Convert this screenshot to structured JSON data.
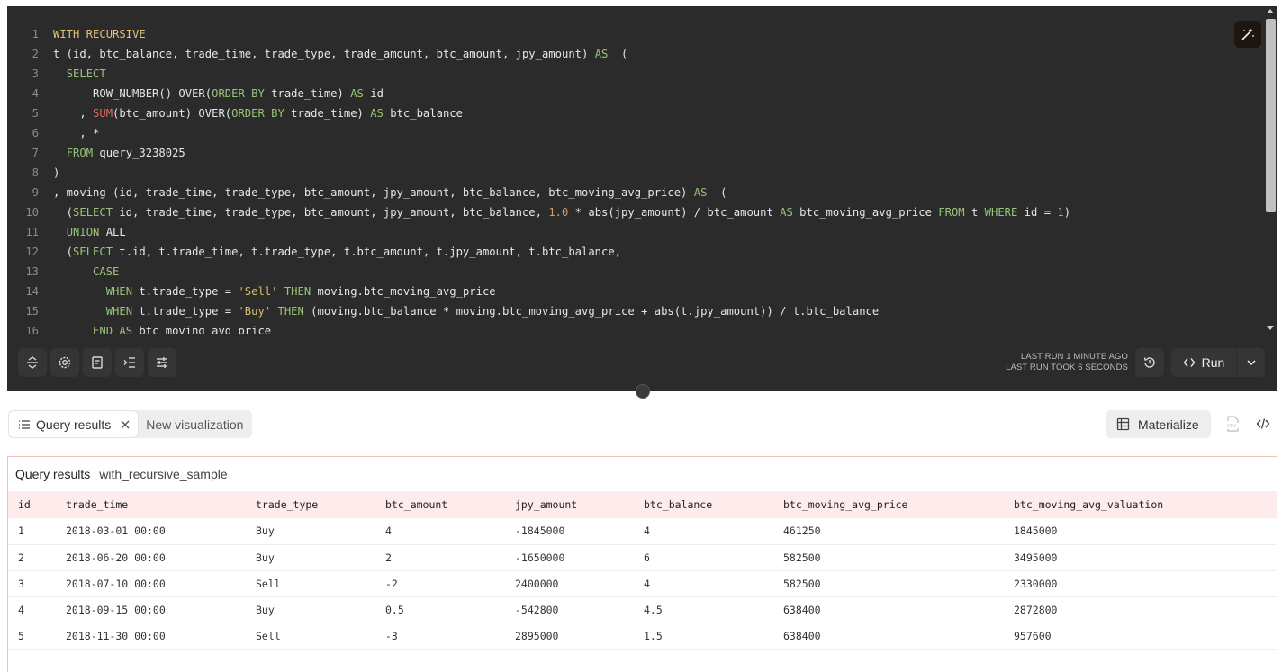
{
  "editor": {
    "lines": [
      {
        "n": "1",
        "parts": [
          [
            "kw",
            "WITH RECURSIVE"
          ]
        ]
      },
      {
        "n": "2",
        "parts": [
          [
            "",
            "t (id, btc_balance, trade_time, trade_type, trade_amount, btc_amount, jpy_amount) "
          ],
          [
            "green",
            "AS"
          ],
          [
            "",
            "  ("
          ]
        ]
      },
      {
        "n": "3",
        "parts": [
          [
            "",
            "  "
          ],
          [
            "green",
            "SELECT"
          ]
        ]
      },
      {
        "n": "4",
        "parts": [
          [
            "",
            "      ROW_NUMBER() OVER("
          ],
          [
            "green",
            "ORDER BY"
          ],
          [
            "",
            " trade_time) "
          ],
          [
            "green",
            "AS"
          ],
          [
            "",
            " id"
          ]
        ]
      },
      {
        "n": "5",
        "parts": [
          [
            "",
            "    , "
          ],
          [
            "fn-red",
            "SUM"
          ],
          [
            "",
            "(btc_amount) OVER("
          ],
          [
            "green",
            "ORDER BY"
          ],
          [
            "",
            " trade_time) "
          ],
          [
            "green",
            "AS"
          ],
          [
            "",
            " btc_balance"
          ]
        ]
      },
      {
        "n": "6",
        "parts": [
          [
            "",
            "    , *"
          ]
        ]
      },
      {
        "n": "7",
        "parts": [
          [
            "",
            "  "
          ],
          [
            "green",
            "FROM"
          ],
          [
            "",
            " query_3238025"
          ]
        ]
      },
      {
        "n": "8",
        "parts": [
          [
            "",
            ")"
          ]
        ]
      },
      {
        "n": "9",
        "parts": [
          [
            "",
            ", moving (id, trade_time, trade_type, btc_amount, jpy_amount, btc_balance, btc_moving_avg_price) "
          ],
          [
            "green",
            "AS"
          ],
          [
            "",
            "  ("
          ]
        ]
      },
      {
        "n": "10",
        "parts": [
          [
            "",
            "  ("
          ],
          [
            "green",
            "SELECT"
          ],
          [
            "",
            " id, trade_time, trade_type, btc_amount, jpy_amount, btc_balance, "
          ],
          [
            "num",
            "1.0"
          ],
          [
            "",
            " * abs(jpy_amount) / btc_amount "
          ],
          [
            "green",
            "AS"
          ],
          [
            "",
            " btc_moving_avg_price "
          ],
          [
            "green",
            "FROM"
          ],
          [
            "",
            " t "
          ],
          [
            "green",
            "WHERE"
          ],
          [
            "",
            " id = "
          ],
          [
            "num",
            "1"
          ],
          [
            "",
            ")"
          ]
        ]
      },
      {
        "n": "11",
        "parts": [
          [
            "",
            "  "
          ],
          [
            "green",
            "UNION"
          ],
          [
            "",
            " ALL"
          ]
        ]
      },
      {
        "n": "12",
        "parts": [
          [
            "",
            "  ("
          ],
          [
            "green",
            "SELECT"
          ],
          [
            "",
            " t.id, t.trade_time, t.trade_type, t.btc_amount, t.jpy_amount, t.btc_balance,"
          ]
        ]
      },
      {
        "n": "13",
        "parts": [
          [
            "",
            "      "
          ],
          [
            "green",
            "CASE"
          ]
        ]
      },
      {
        "n": "14",
        "parts": [
          [
            "",
            "        "
          ],
          [
            "green",
            "WHEN"
          ],
          [
            "",
            " t.trade_type = "
          ],
          [
            "str",
            "'Sell'"
          ],
          [
            "",
            ""
          ],
          [
            "green",
            " THEN"
          ],
          [
            "",
            " moving.btc_moving_avg_price"
          ]
        ]
      },
      {
        "n": "15",
        "parts": [
          [
            "",
            "        "
          ],
          [
            "green",
            "WHEN"
          ],
          [
            "",
            " t.trade_type = "
          ],
          [
            "str",
            "'Buy'"
          ],
          [
            "green",
            " THEN"
          ],
          [
            "",
            " (moving.btc_balance * moving.btc_moving_avg_price + abs(t.jpy_amount)) / t.btc_balance"
          ]
        ]
      },
      {
        "n": "16",
        "parts": [
          [
            "",
            "      "
          ],
          [
            "green",
            "END AS"
          ],
          [
            "",
            " btc_moving_avg_price"
          ]
        ]
      }
    ]
  },
  "toolbar": {
    "last_run": "LAST RUN 1 MINUTE AGO",
    "last_run_took": "LAST RUN TOOK 6 SECONDS",
    "run_label": "Run"
  },
  "tabs": {
    "active": "Query results",
    "inactive": "New visualization"
  },
  "materialize_label": "Materialize",
  "results": {
    "title": "Query results",
    "query_name": "with_recursive_sample",
    "columns": [
      "id",
      "trade_time",
      "trade_type",
      "btc_amount",
      "jpy_amount",
      "btc_balance",
      "btc_moving_avg_price",
      "btc_moving_avg_valuation"
    ],
    "rows": [
      [
        "1",
        "2018-03-01 00:00",
        "Buy",
        "4",
        "-1845000",
        "4",
        "461250",
        "1845000"
      ],
      [
        "2",
        "2018-06-20 00:00",
        "Buy",
        "2",
        "-1650000",
        "6",
        "582500",
        "3495000"
      ],
      [
        "3",
        "2018-07-10 00:00",
        "Sell",
        "-2",
        "2400000",
        "4",
        "582500",
        "2330000"
      ],
      [
        "4",
        "2018-09-15 00:00",
        "Buy",
        "0.5",
        "-542800",
        "4.5",
        "638400",
        "2872800"
      ],
      [
        "5",
        "2018-11-30 00:00",
        "Sell",
        "-3",
        "2895000",
        "1.5",
        "638400",
        "957600"
      ]
    ]
  }
}
